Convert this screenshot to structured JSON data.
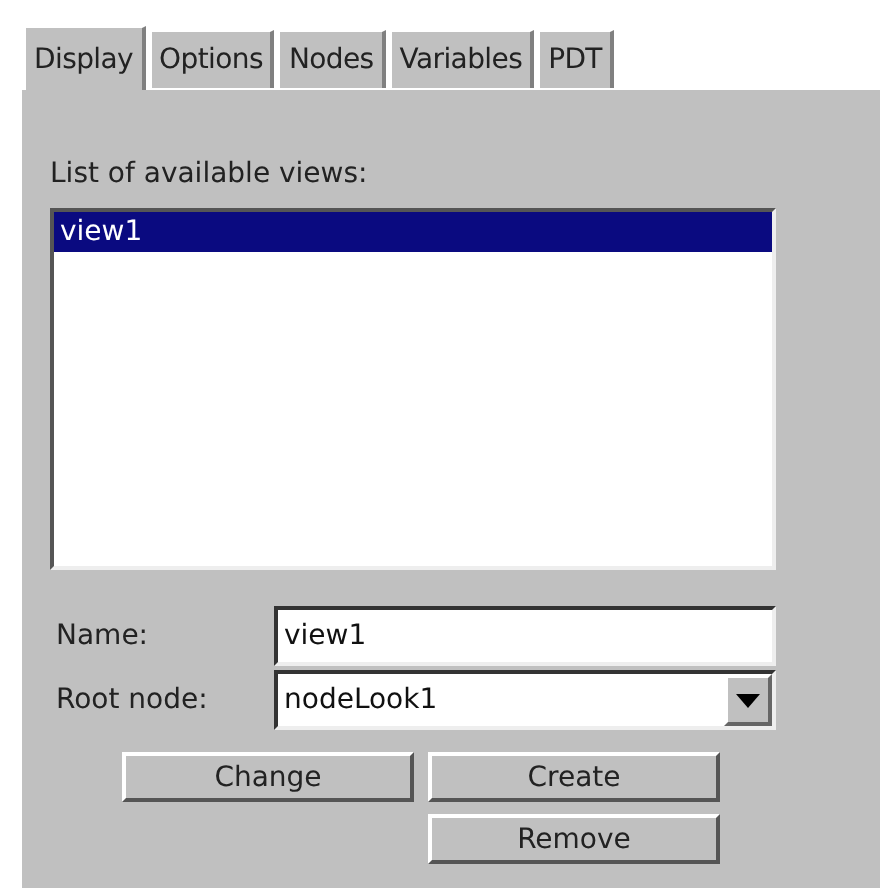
{
  "tabs": [
    {
      "label": "Display",
      "selected": true
    },
    {
      "label": "Options",
      "selected": false
    },
    {
      "label": "Nodes",
      "selected": false
    },
    {
      "label": "Variables",
      "selected": false
    },
    {
      "label": "PDT",
      "selected": false
    }
  ],
  "views_label": "List of available views:",
  "views": [
    {
      "label": "view1",
      "selected": true
    }
  ],
  "name": {
    "label": "Name:",
    "value": "view1"
  },
  "root_node": {
    "label": "Root node:",
    "value": "nodeLook1"
  },
  "buttons": [
    {
      "label": "Change"
    },
    {
      "label": "Create"
    },
    {
      "label": "Remove"
    }
  ]
}
